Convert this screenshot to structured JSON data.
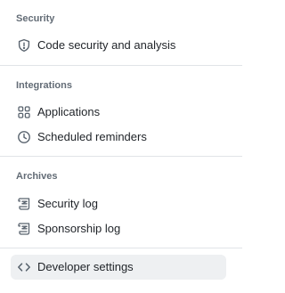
{
  "sections": [
    {
      "heading": "Security",
      "items": [
        {
          "label": "Code security and analysis",
          "icon": "shield-icon"
        }
      ]
    },
    {
      "heading": "Integrations",
      "items": [
        {
          "label": "Applications",
          "icon": "apps-grid-icon"
        },
        {
          "label": "Scheduled reminders",
          "icon": "clock-icon"
        }
      ]
    },
    {
      "heading": "Archives",
      "items": [
        {
          "label": "Security log",
          "icon": "log-icon"
        },
        {
          "label": "Sponsorship log",
          "icon": "log-icon"
        }
      ]
    }
  ],
  "developer_settings": {
    "label": "Developer settings",
    "icon": "code-icon",
    "active": true
  },
  "colors": {
    "text": "#1f2328",
    "heading": "#636c76",
    "icon": "#59636e",
    "divider": "#e1e4e8",
    "active_bg": "#eef0f2"
  }
}
